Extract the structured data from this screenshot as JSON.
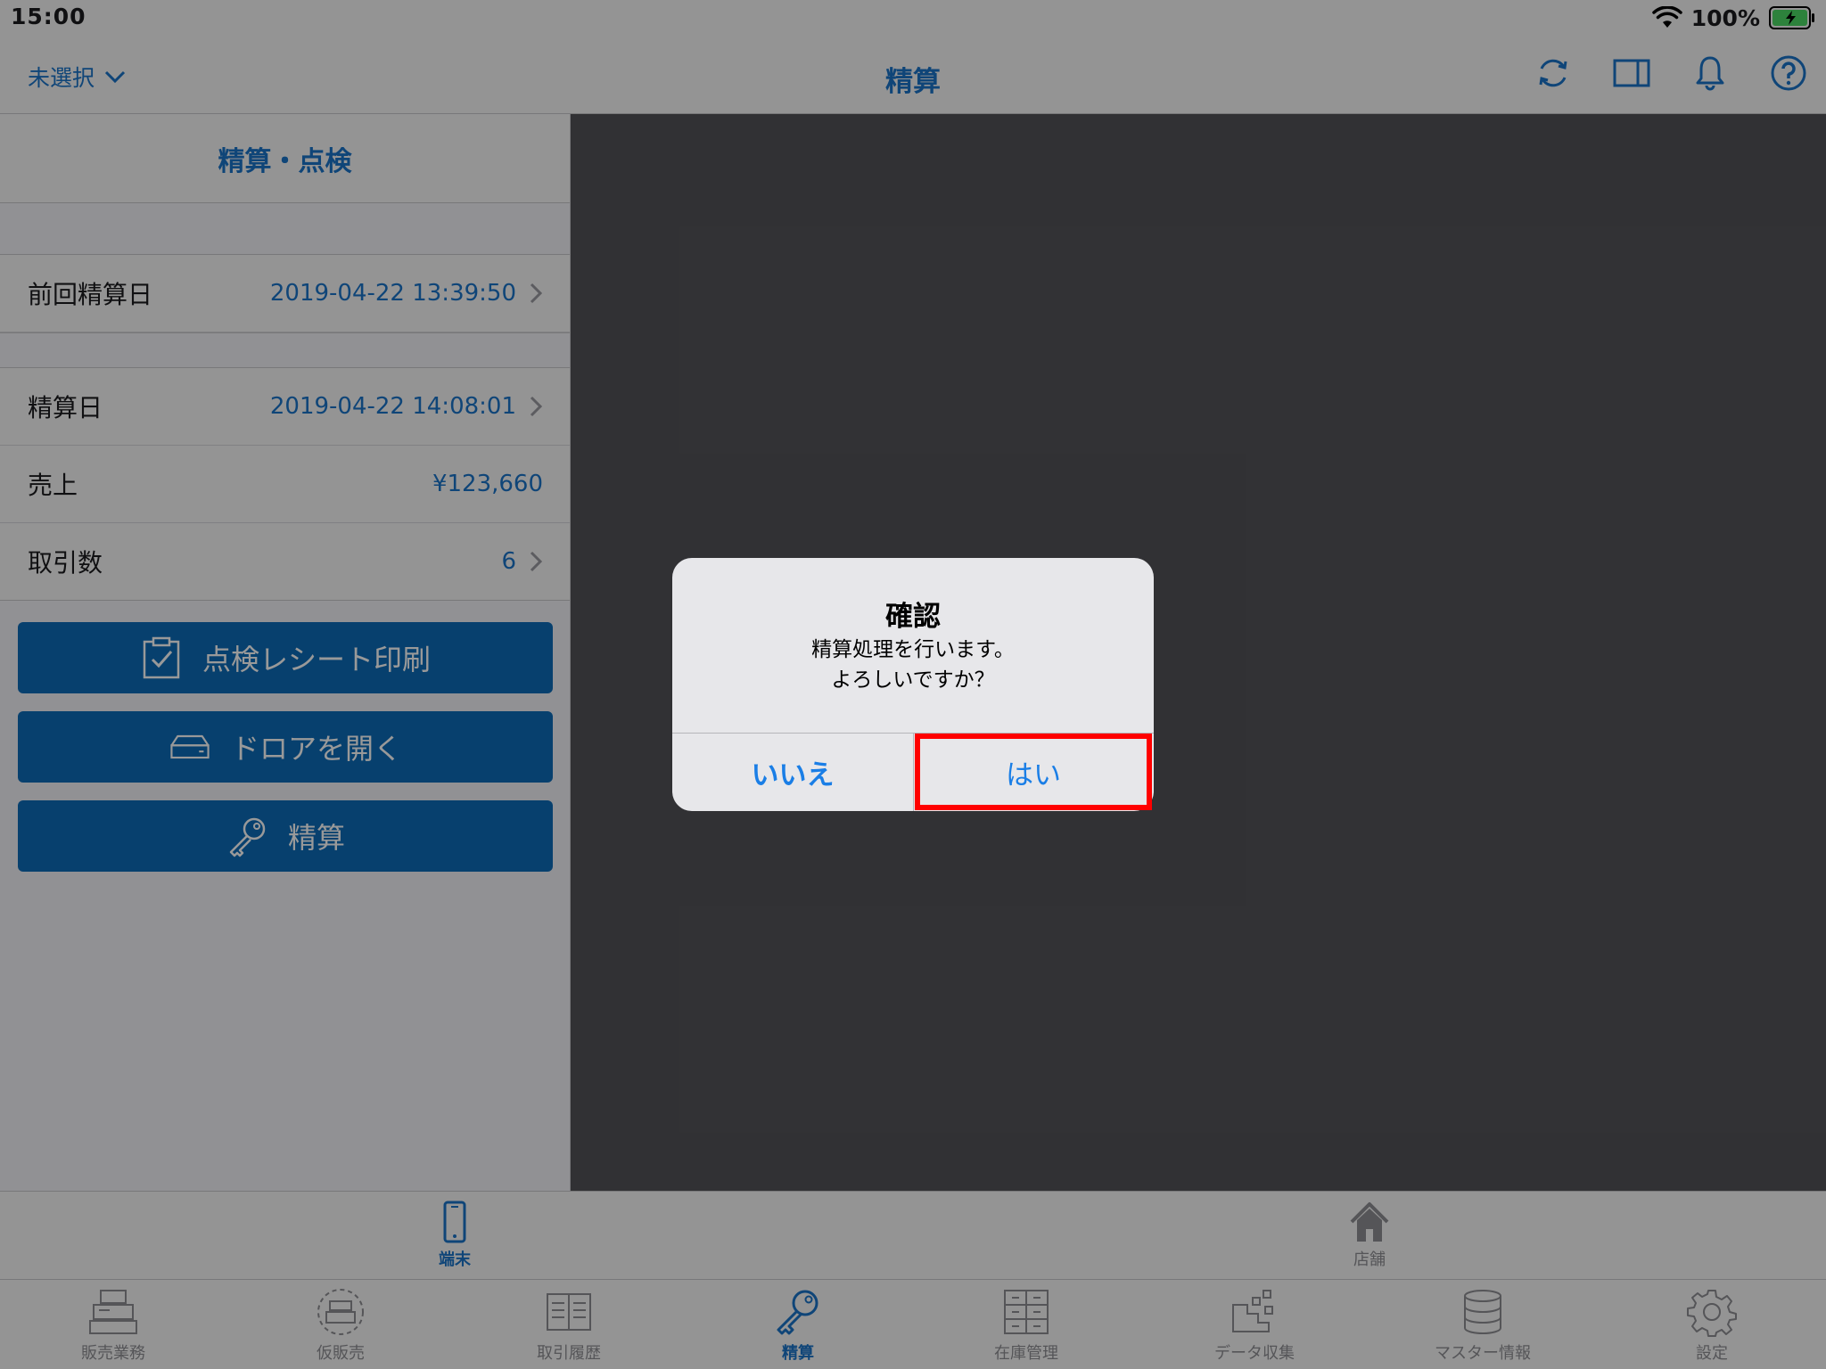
{
  "status_bar": {
    "time": "15:00",
    "battery": "100%"
  },
  "nav": {
    "store_selector": "未選択",
    "title": "精算"
  },
  "left_pane": {
    "header": "精算・点検",
    "rows": [
      {
        "label": "前回精算日",
        "value": "2019-04-22 13:39:50"
      },
      {
        "label": "精算日",
        "value": "2019-04-22 14:08:01"
      },
      {
        "label": "売上",
        "value": "¥123,660"
      },
      {
        "label": "取引数",
        "value": "6"
      }
    ],
    "buttons": {
      "print": "点検レシート印刷",
      "drawer": "ドロアを開く",
      "settle": "精算"
    }
  },
  "scope_bar": {
    "terminal": "端末",
    "store": "店舗"
  },
  "tabs": [
    {
      "label": "販売業務",
      "icon": "register-icon"
    },
    {
      "label": "仮販売",
      "icon": "temp-register-icon"
    },
    {
      "label": "取引履歴",
      "icon": "history-icon"
    },
    {
      "label": "精算",
      "icon": "key-icon"
    },
    {
      "label": "在庫管理",
      "icon": "inventory-icon"
    },
    {
      "label": "データ収集",
      "icon": "data-collection-icon"
    },
    {
      "label": "マスター情報",
      "icon": "database-icon"
    },
    {
      "label": "設定",
      "icon": "gear-icon"
    }
  ],
  "dialog": {
    "title": "確認",
    "message_line1": "精算処理を行います。",
    "message_line2": "よろしいですか？",
    "no": "いいえ",
    "yes": "はい"
  },
  "colors": {
    "accent": "#1a73c9",
    "button": "#0c6bb8",
    "highlight": "#ff0000"
  }
}
